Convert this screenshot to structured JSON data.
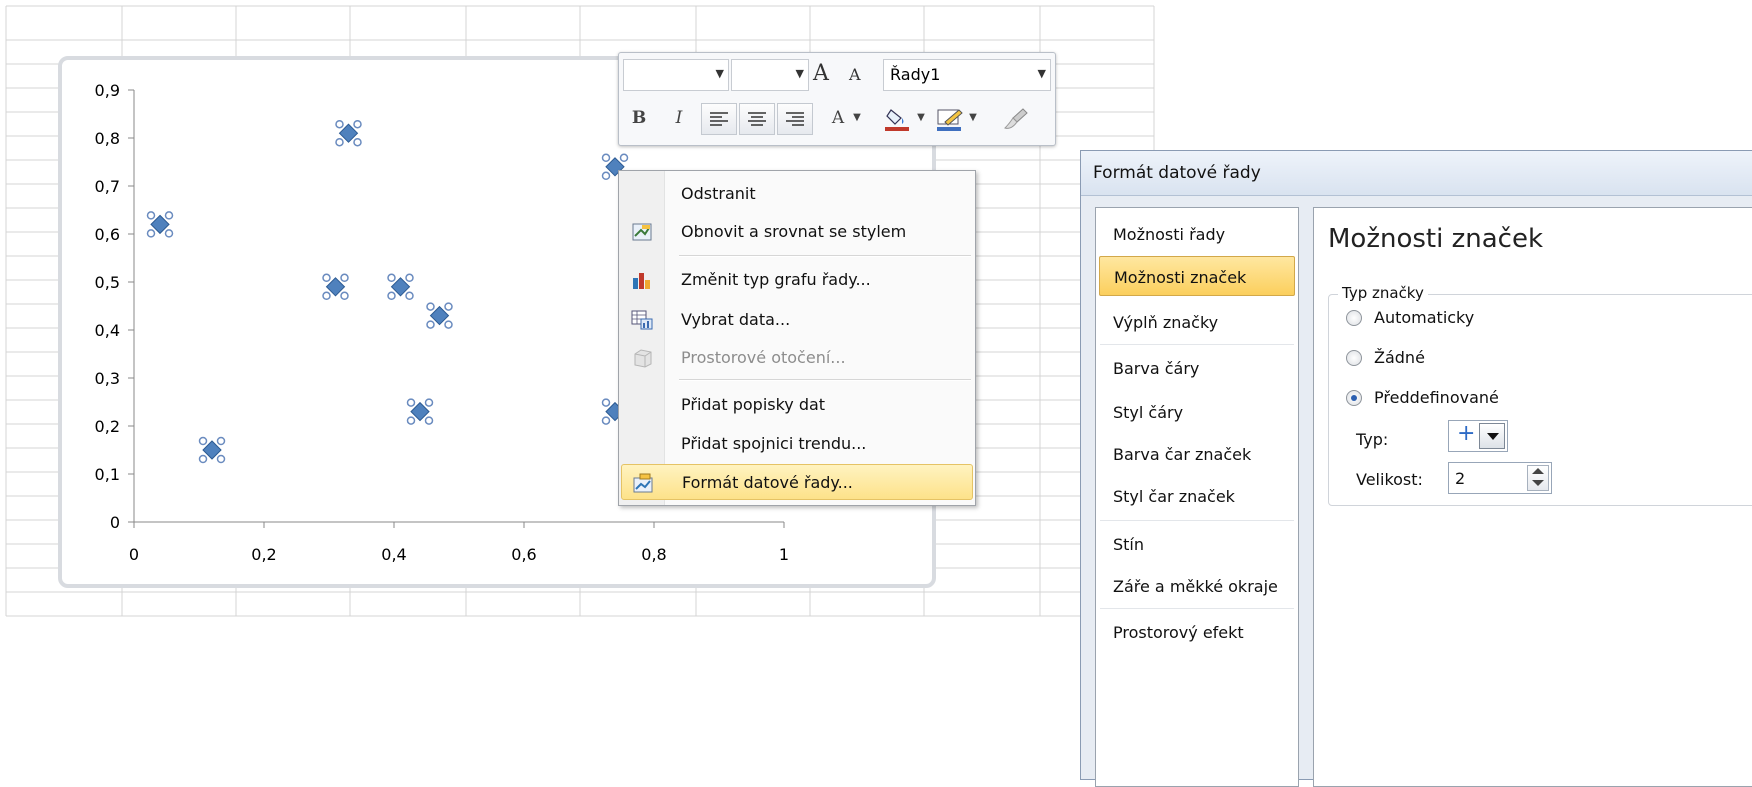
{
  "chart_data": {
    "type": "scatter",
    "series": [
      {
        "points": [
          [
            0.04,
            0.62
          ],
          [
            0.12,
            0.15
          ],
          [
            0.31,
            0.49
          ],
          [
            0.33,
            0.81
          ],
          [
            0.41,
            0.49
          ],
          [
            0.44,
            0.23
          ],
          [
            0.47,
            0.43
          ],
          [
            0.74,
            0.74
          ],
          [
            0.74,
            0.23
          ]
        ]
      }
    ],
    "xlim": [
      0,
      1
    ],
    "ylim": [
      0,
      0.9
    ],
    "x_ticks": [
      "0",
      "0,2",
      "0,4",
      "0,6",
      "0,8",
      "1"
    ],
    "y_ticks": [
      "0",
      "0,1",
      "0,2",
      "0,3",
      "0,4",
      "0,5",
      "0,6",
      "0,7",
      "0,8",
      "0,9"
    ],
    "marker_color": "#4f81bd",
    "selection_handle_color": "#6a8bbf",
    "title": "",
    "xlabel": "",
    "ylabel": "",
    "grid": false
  },
  "mini_toolbar": {
    "series_selector": "Řady1",
    "font_grow": "A",
    "font_shrink": "A",
    "bold": "B",
    "italic": "I",
    "font_color": "A"
  },
  "context_menu": {
    "items": [
      {
        "label": "Odstranit",
        "icon": "none",
        "disabled": false,
        "selected": false
      },
      {
        "label": "Obnovit a srovnat se stylem",
        "icon": "reset-style-icon",
        "disabled": false,
        "selected": false
      },
      {
        "label": "Změnit typ grafu řady...",
        "icon": "chart-type-icon",
        "disabled": false,
        "selected": false
      },
      {
        "label": "Vybrat data...",
        "icon": "select-data-icon",
        "disabled": false,
        "selected": false
      },
      {
        "label": "Prostorové otočení...",
        "icon": "3d-rotation-icon",
        "disabled": true,
        "selected": false
      },
      {
        "label": "Přidat popisky dat",
        "icon": "none",
        "disabled": false,
        "selected": false
      },
      {
        "label": "Přidat spojnici trendu...",
        "icon": "none",
        "disabled": false,
        "selected": false
      },
      {
        "label": "Formát datové řady...",
        "icon": "format-series-icon",
        "disabled": false,
        "selected": true
      }
    ]
  },
  "dialog": {
    "title": "Formát datové řady",
    "nav": [
      "Možnosti řady",
      "Možnosti značek",
      "Výplň značky",
      "Barva čáry",
      "Styl čáry",
      "Barva čar značek",
      "Styl čar značek",
      "Stín",
      "Záře a měkké okraje",
      "Prostorový efekt"
    ],
    "active_nav": "Možnosti značek",
    "content_heading": "Možnosti značek",
    "group_label": "Typ značky",
    "radios": [
      {
        "label": "Automaticky",
        "checked": false
      },
      {
        "label": "Žádné",
        "checked": false
      },
      {
        "label": "Předdefinované",
        "checked": true
      }
    ],
    "type_label": "Typ:",
    "type_value": "+",
    "size_label": "Velikost:",
    "size_value": "2"
  }
}
